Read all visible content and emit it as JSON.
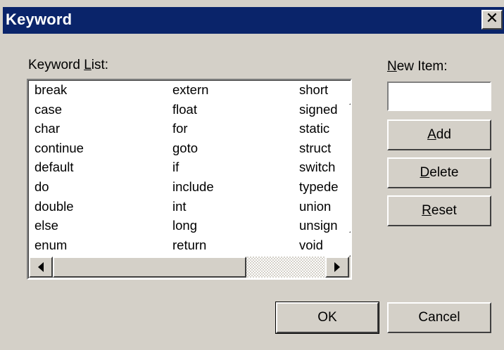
{
  "window": {
    "title": "Keyword",
    "close_glyph": "✕"
  },
  "keyword_list": {
    "label_prefix": "Keyword ",
    "label_accel": "L",
    "label_suffix": "ist:",
    "columns": [
      [
        "break",
        "case",
        "char",
        "continue",
        "default",
        "do",
        "double",
        "else",
        "enum"
      ],
      [
        "extern",
        "float",
        "for",
        "goto",
        "if",
        "include",
        "int",
        "long",
        "return"
      ],
      [
        "short",
        "signed",
        "static",
        "struct",
        "switch",
        "typede",
        "union",
        "unsign",
        "void"
      ]
    ]
  },
  "new_item": {
    "label_accel": "N",
    "label_suffix": "ew Item:",
    "value": "",
    "placeholder": ""
  },
  "buttons": {
    "add": {
      "accel": "A",
      "rest": "dd"
    },
    "delete": {
      "accel": "D",
      "rest": "elete"
    },
    "reset": {
      "accel": "R",
      "rest": "eset"
    },
    "ok": "OK",
    "cancel": "Cancel"
  },
  "icons": {
    "arrow_up": "triangle-up-icon",
    "arrow_down": "triangle-down-icon",
    "arrow_left": "triangle-left-icon",
    "arrow_right": "triangle-right-icon"
  },
  "colors": {
    "titlebar": "#0a246a",
    "face": "#d4d0c8"
  }
}
